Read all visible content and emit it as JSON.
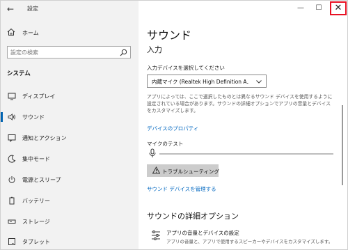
{
  "app": {
    "title": "設定",
    "back_label": "←"
  },
  "sidebar": {
    "home_label": "ホーム",
    "search_placeholder": "設定の検索",
    "section_heading": "システム",
    "items": [
      {
        "label": "ディスプレイ",
        "icon": "display-icon",
        "selected": false
      },
      {
        "label": "サウンド",
        "icon": "speaker-icon",
        "selected": true
      },
      {
        "label": "通知とアクション",
        "icon": "notification-icon",
        "selected": false
      },
      {
        "label": "集中モード",
        "icon": "moon-icon",
        "selected": false
      },
      {
        "label": "電源とスリープ",
        "icon": "power-icon",
        "selected": false
      },
      {
        "label": "バッテリー",
        "icon": "battery-icon",
        "selected": false
      },
      {
        "label": "ストレージ",
        "icon": "storage-icon",
        "selected": false
      },
      {
        "label": "タブレット",
        "icon": "tablet-icon",
        "selected": false
      }
    ]
  },
  "window_controls": {
    "minimize": "—",
    "maximize": "☐",
    "close": "✕"
  },
  "main": {
    "page_title": "サウンド",
    "input_section": "入力",
    "device_label": "入力デバイスを選択してください",
    "device_value": "内蔵マイク (Realtek High Definition A...",
    "description": "アプリによっては、ここで選択したものとは異なるサウンド デバイスを使用するように設定されている場合があります。サウンドの詳細オプションでアプリの音量とデバイスをカスタマイズします。",
    "device_properties_link": "デバイスのプロパティ",
    "mic_test_label": "マイクのテスト",
    "mic_level": 0,
    "troubleshoot_label": "トラブルシューティング",
    "manage_devices_link": "サウンド デバイスを管理する",
    "advanced_title": "サウンドの詳細オプション",
    "advanced_item_title": "アプリの音量とデバイスの設定",
    "advanced_item_subtitle": "アプリの音量と、アプリで使用するスピーカーやデバイスをカスタマイズします。"
  },
  "colors": {
    "accent": "#0063b1",
    "link": "#0067c0",
    "close_highlight": "#e81123",
    "sidebar_bg": "#f2f2f2"
  }
}
